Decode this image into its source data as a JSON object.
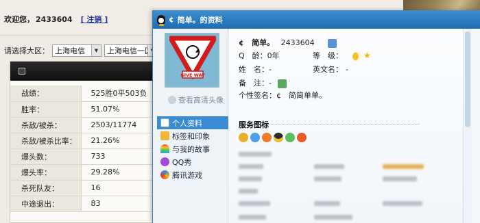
{
  "page": {
    "welcome_text": "欢迎您，",
    "user_id": "2433604",
    "logout_label": "[ 注销 ]",
    "region_label": "请选择大区：",
    "region_select_1": "上海电信",
    "region_select_2": "上海电信一区"
  },
  "stats": [
    {
      "label": "战绩：",
      "value": "525胜0平503负"
    },
    {
      "label": "胜率：",
      "value": "51.07%"
    },
    {
      "label": "杀敌/被杀：",
      "value": "2503/11774"
    },
    {
      "label": "杀敌/被杀比率：",
      "value": "21.26%"
    },
    {
      "label": "爆头数：",
      "value": "733"
    },
    {
      "label": "爆头率：",
      "value": "29.28%"
    },
    {
      "label": "杀死队友：",
      "value": "16"
    },
    {
      "label": "中途退出：",
      "value": "83"
    }
  ],
  "dialog": {
    "title_prefix": "¢",
    "title": "简单。的资料",
    "avatar_sign_text": "GIVE WAY",
    "hd_avatar_label": "查看高清头像",
    "nav": [
      {
        "label": "个人资料",
        "icon": "profile-icon"
      },
      {
        "label": "标签和印象",
        "icon": "tag-icon"
      },
      {
        "label": "与我的故事",
        "icon": "rainbow-icon"
      },
      {
        "label": "QQ秀",
        "icon": "qqshow-icon"
      },
      {
        "label": "腾讯游戏",
        "icon": "tencent-games-icon"
      }
    ],
    "profile": {
      "nick_prefix": "¢",
      "nickname": "简单。",
      "qq_number": "2433604",
      "age_label": "Q　龄：",
      "age_value": "0年",
      "level_label": "等　级：",
      "name_label": "姓　名：",
      "name_value": "-",
      "en_name_label": "英文名：",
      "en_name_value": "-",
      "remark_label": "备　注：",
      "remark_value": "-",
      "signature_label": "个性签名：",
      "signature_value": "¢　简简单单。"
    },
    "service_title": "服务图标",
    "colors": {
      "titlebar": "#1e6db0",
      "nav_active": "#3a8bd1"
    }
  }
}
